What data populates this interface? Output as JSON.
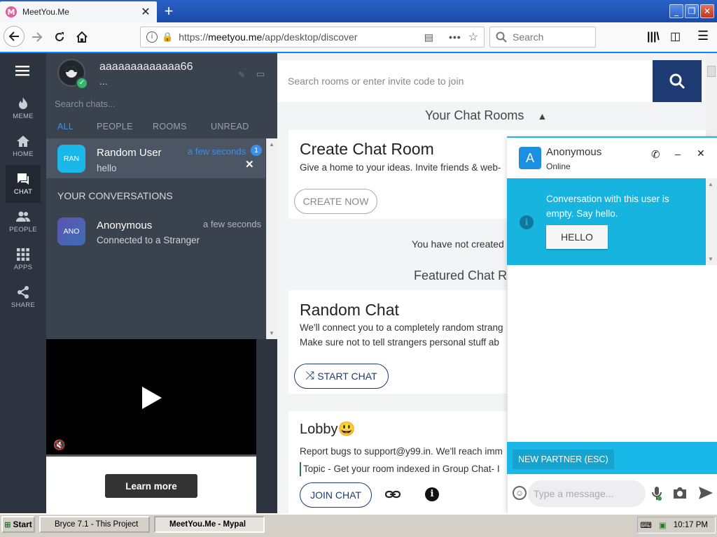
{
  "browser": {
    "tab_title": "MeetYou.Me",
    "tab_icon_letter": "M",
    "url_protocol": "https://",
    "url_domain": "meetyou.me",
    "url_path": "/app/desktop/discover",
    "search_placeholder": "Search"
  },
  "user": {
    "name": "aaaaaaaaaaaaa66",
    "status": "..."
  },
  "rail": [
    {
      "label": "MEME",
      "icon": "flame-icon"
    },
    {
      "label": "HOME",
      "icon": "home-icon"
    },
    {
      "label": "CHAT",
      "icon": "chat-icon",
      "active": true
    },
    {
      "label": "PEOPLE",
      "icon": "people-icon"
    },
    {
      "label": "APPS",
      "icon": "apps-icon"
    },
    {
      "label": "SHARE",
      "icon": "share-icon"
    }
  ],
  "chats": {
    "search_placeholder": "Search chats...",
    "filters": [
      "ALL",
      "PEOPLE",
      "ROOMS",
      "UNREAD"
    ],
    "active_chat": {
      "avatar": "RAN",
      "name": "Random User",
      "message": "hello",
      "time": "a few seconds",
      "unread": "1"
    },
    "section_title": "YOUR CONVERSATIONS",
    "conversation": {
      "avatar": "ANO",
      "name": "Anonymous",
      "message": "Connected to a Stranger",
      "time": "a few seconds"
    }
  },
  "ad": {
    "cta": "Learn more"
  },
  "main": {
    "search_placeholder": "Search rooms or enter invite code to join",
    "your_rooms": "Your Chat Rooms",
    "create": {
      "title": "Create Chat Room",
      "desc": "Give a home to your ideas. Invite friends & web-",
      "button": "CREATE NOW"
    },
    "not_created": "You have not created",
    "featured": "Featured Chat Ro",
    "random": {
      "title": "Random Chat",
      "line1": "We'll connect you to a completely random strang",
      "line2": "Make sure not to tell strangers personal stuff ab",
      "button": "START CHAT"
    },
    "lobby": {
      "title": "Lobby😃",
      "line1": "Report bugs to support@y99.in. We'll reach imm",
      "line2": "Topic - Get your room indexed in Group Chat- I",
      "button": "JOIN CHAT"
    }
  },
  "popup": {
    "avatar": "A",
    "name": "Anonymous",
    "status": "Online",
    "empty_message": "Conversation with this user is empty. Say hello.",
    "hello_button": "HELLO",
    "new_partner": "NEW PARTNER (ESC)",
    "message_placeholder": "Type a message..."
  },
  "taskbar": {
    "start": "Start",
    "tasks": [
      "Bryce 7.1 - This Project",
      "MeetYou.Me - Mypal"
    ],
    "clock": "10:17 PM"
  }
}
